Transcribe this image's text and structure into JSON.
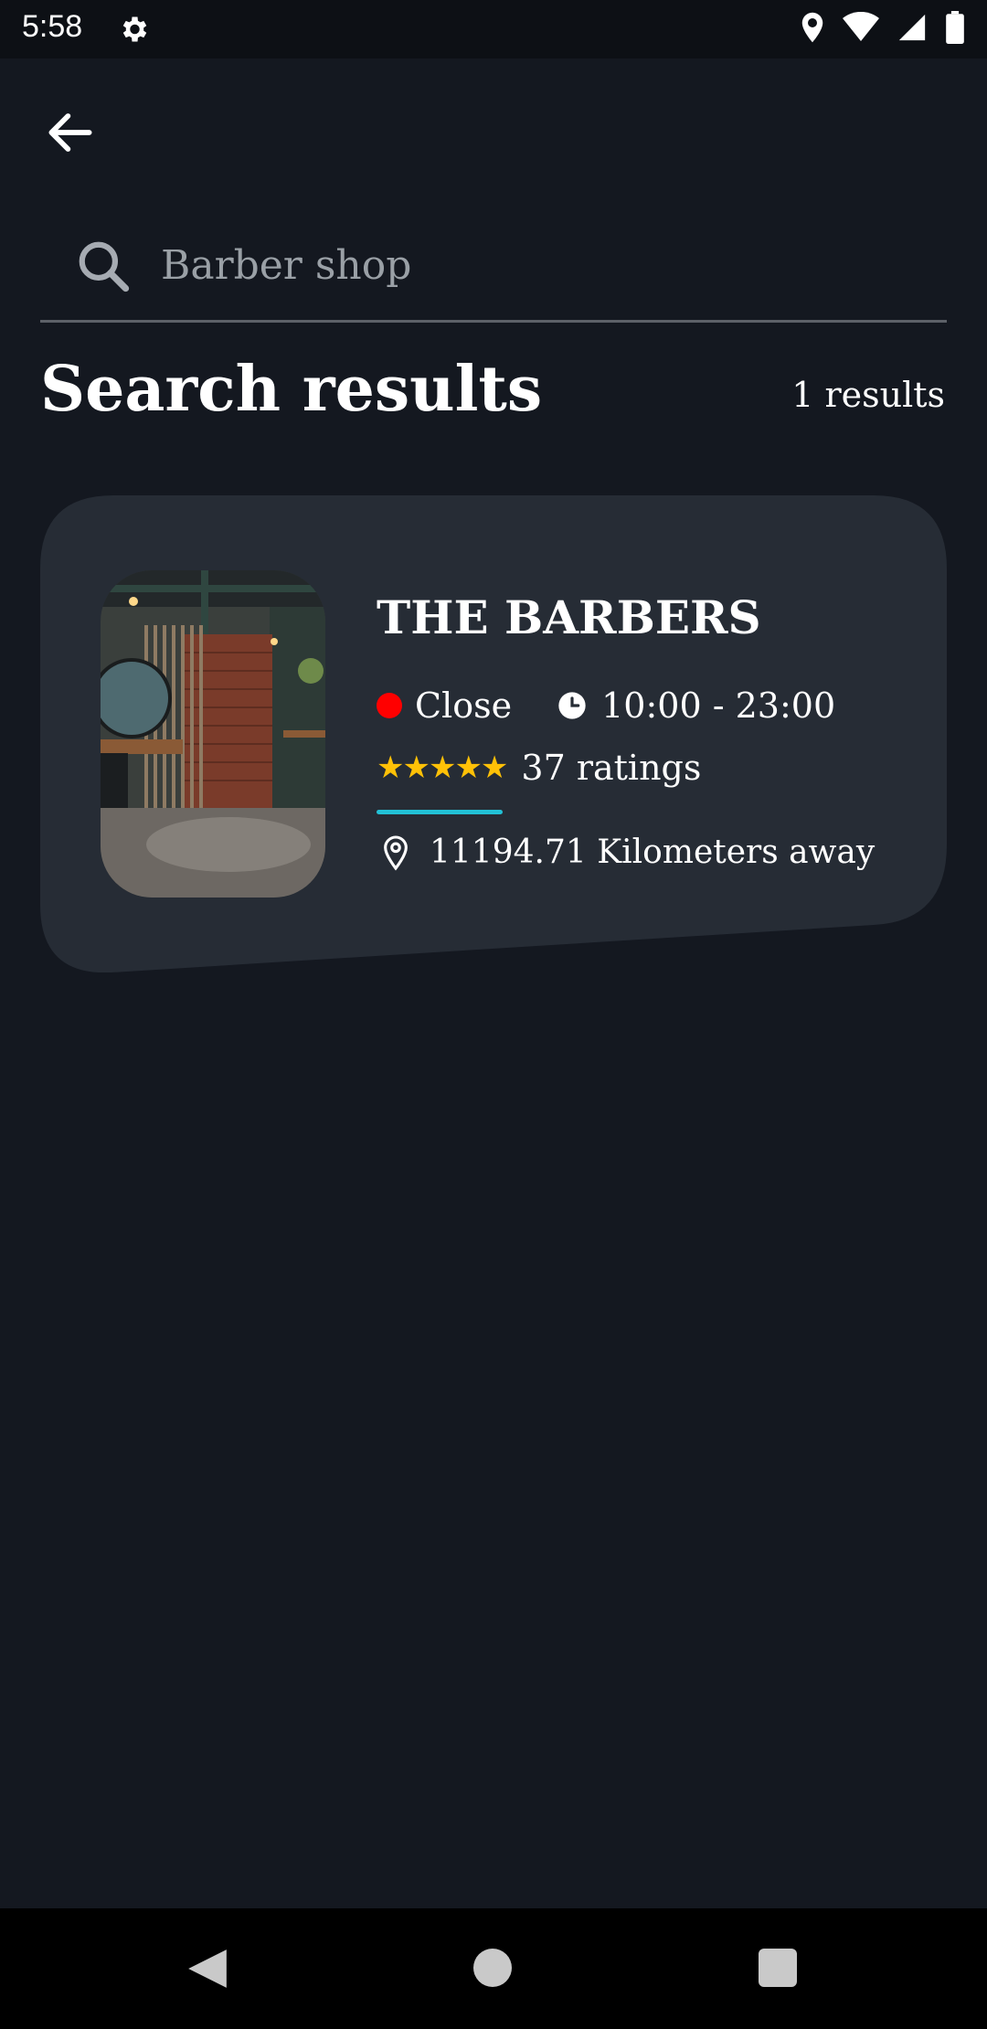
{
  "status_bar": {
    "time": "5:58"
  },
  "search": {
    "placeholder": "Barber shop"
  },
  "header": {
    "title": "Search results",
    "results_count": "1 results"
  },
  "results": [
    {
      "name": "THE BARBERS",
      "open_status": "Close",
      "hours": "10:00 - 23:00",
      "stars": "★★★★★",
      "rating_value": 5,
      "ratings_label": "37 ratings",
      "distance": "11194.71 Kilometers away"
    }
  ],
  "colors": {
    "background": "#141820",
    "card": "#262c35",
    "closed_dot": "#ff0000",
    "star": "#ffc107",
    "accent_bar": "#22c1d6"
  },
  "icons": {
    "back": "arrow-left-icon",
    "search": "search-icon",
    "clock": "clock-icon",
    "location": "location-pin-icon",
    "settings": "gear-icon"
  }
}
